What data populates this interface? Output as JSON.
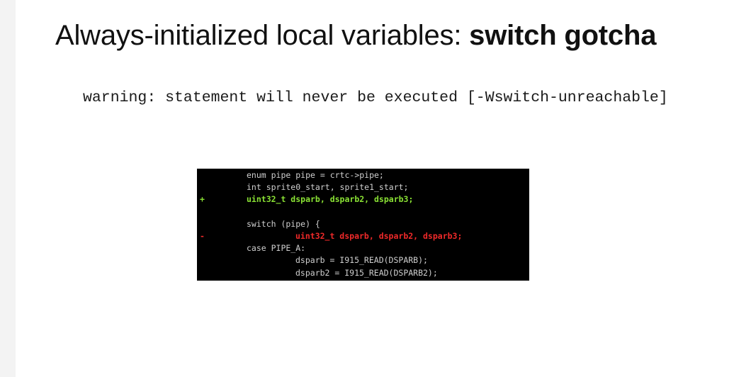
{
  "slide": {
    "title_regular": "Always-initialized local variables: ",
    "title_bold": "switch gotcha",
    "warning": "warning: statement will never be executed [-Wswitch-unreachable]"
  },
  "code": {
    "lines": [
      {
        "marker": "",
        "text": "enum pipe pipe = crtc->pipe;",
        "kind": "normal",
        "indent": 1
      },
      {
        "marker": "",
        "text": "int sprite0_start, sprite1_start;",
        "kind": "normal",
        "indent": 1
      },
      {
        "marker": "+",
        "text": "uint32_t dsparb, dsparb2, dsparb3;",
        "kind": "added",
        "indent": 1
      },
      {
        "marker": "",
        "text": "",
        "kind": "normal",
        "indent": 1
      },
      {
        "marker": "",
        "text": "switch (pipe) {",
        "kind": "normal",
        "indent": 1
      },
      {
        "marker": "-",
        "text": "uint32_t dsparb, dsparb2, dsparb3;",
        "kind": "removed",
        "indent": 2
      },
      {
        "marker": "",
        "text": "case PIPE_A:",
        "kind": "normal",
        "indent": 1
      },
      {
        "marker": "",
        "text": "dsparb = I915_READ(DSPARB);",
        "kind": "normal",
        "indent": 2
      },
      {
        "marker": "",
        "text": "dsparb2 = I915_READ(DSPARB2);",
        "kind": "normal",
        "indent": 2
      }
    ],
    "colors": {
      "background": "#000000",
      "normal": "#cfcfcf",
      "added": "#8ae234",
      "removed": "#ef2929"
    }
  }
}
